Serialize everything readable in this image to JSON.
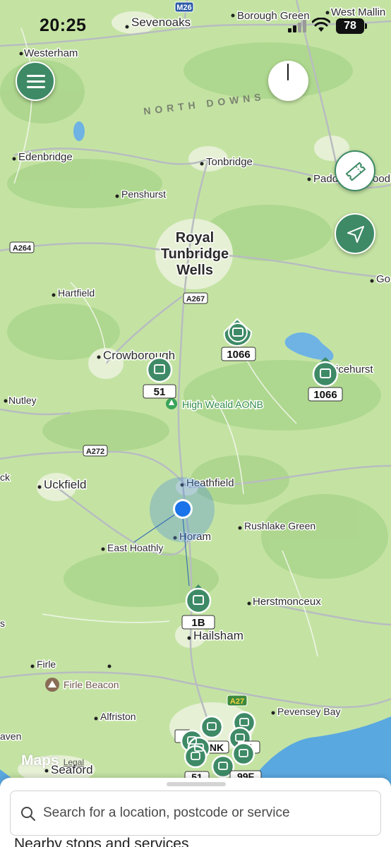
{
  "status_bar": {
    "time": "20:25",
    "battery": "78"
  },
  "map": {
    "places": [
      "Sevenoaks",
      "Westerham",
      "Borough Green",
      "West Mallin",
      "Edenbridge",
      "Tonbridge",
      "Padd",
      "ood",
      "Penshurst",
      "Royal",
      "Tunbridge",
      "Wells",
      "Hartfield",
      "Go",
      "Crowborough",
      "Nutley",
      "icehurst",
      "Uckfield",
      "Heathfield",
      "East Hoathly",
      "Horam",
      "Rushlake Green",
      "Herstmonceux",
      "ck",
      "s",
      "Hailsham",
      "Firle",
      "Alfriston",
      "Pevensey Bay",
      "aven",
      "Seaford",
      "NK",
      "K"
    ],
    "region_label": "NORTH DOWNS",
    "poi": [
      "High Weald AONB",
      "Firle Beacon"
    ],
    "roads": [
      "M26",
      "A264",
      "A267",
      "A272",
      "A27"
    ],
    "bus_stops": [
      "1066",
      "51",
      "1066",
      "1B",
      "51",
      "99F"
    ]
  },
  "icons": {
    "menu": "menu-icon",
    "compass": "compass-icon",
    "ticket": "ticket-icon",
    "locate": "location-arrow-icon",
    "bus": "bus-icon",
    "search": "search-icon"
  },
  "colors": {
    "accent": "#3e8a66",
    "sea": "#5aa8e0",
    "user_location": "#1a73e8"
  },
  "attribution": {
    "brand": "Maps",
    "legal": "Legal"
  },
  "search": {
    "placeholder": "Search for a location, postcode or service"
  },
  "sheet": {
    "heading": "Nearby stops and services"
  }
}
